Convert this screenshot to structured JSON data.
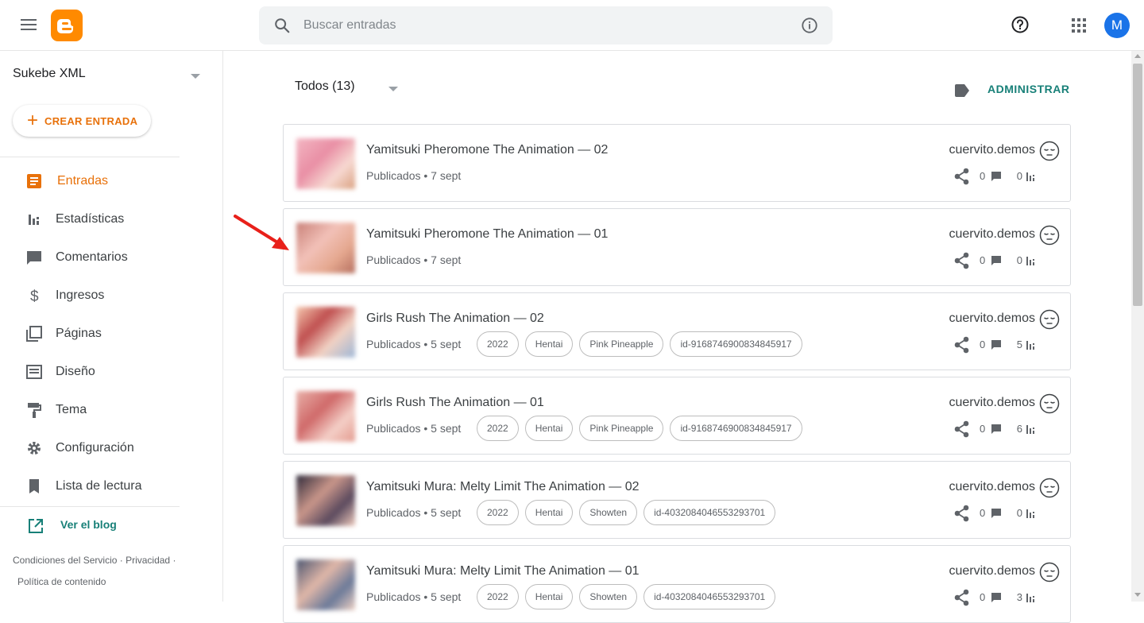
{
  "header": {
    "search_placeholder": "Buscar entradas",
    "avatar_letter": "M",
    "accent": "#ff8a00"
  },
  "sidebar": {
    "blog_name": "Sukebe XML",
    "create_label": "CREAR ENTRADA",
    "items": [
      {
        "label": "Entradas",
        "icon": "posts-icon",
        "active": true
      },
      {
        "label": "Estadísticas",
        "icon": "stats-icon"
      },
      {
        "label": "Comentarios",
        "icon": "comment-icon"
      },
      {
        "label": "Ingresos",
        "icon": "dollar-icon"
      },
      {
        "label": "Páginas",
        "icon": "pages-icon"
      },
      {
        "label": "Diseño",
        "icon": "layout-icon"
      },
      {
        "label": "Tema",
        "icon": "paint-roller-icon"
      },
      {
        "label": "Configuración",
        "icon": "gear-icon"
      },
      {
        "label": "Lista de lectura",
        "icon": "bookmark-icon"
      }
    ],
    "view_blog": "Ver el blog",
    "footer": {
      "terms": "Condiciones del Servicio",
      "privacy": "Privacidad",
      "content_policy": "Política de contenido"
    }
  },
  "main": {
    "filter_label": "Todos (13)",
    "admin_label": "ADMINISTRAR",
    "posts": [
      {
        "title": "Yamitsuki Pheromone The Animation — 02",
        "meta": "Publicados • 7 sept",
        "labels": [],
        "author": "cuervito.demos",
        "comments": "0",
        "views": "0"
      },
      {
        "title": "Yamitsuki Pheromone The Animation — 01",
        "meta": "Publicados • 7 sept",
        "labels": [],
        "author": "cuervito.demos",
        "comments": "0",
        "views": "0"
      },
      {
        "title": "Girls Rush The Animation — 02",
        "meta": "Publicados • 5 sept",
        "labels": [
          "2022",
          "Hentai",
          "Pink Pineapple",
          "id-9168746900834845917"
        ],
        "author": "cuervito.demos",
        "comments": "0",
        "views": "5"
      },
      {
        "title": "Girls Rush The Animation — 01",
        "meta": "Publicados • 5 sept",
        "labels": [
          "2022",
          "Hentai",
          "Pink Pineapple",
          "id-9168746900834845917"
        ],
        "author": "cuervito.demos",
        "comments": "0",
        "views": "6"
      },
      {
        "title": "Yamitsuki Mura: Melty Limit The Animation — 02",
        "meta": "Publicados • 5 sept",
        "labels": [
          "2022",
          "Hentai",
          "Showten",
          "id-4032084046553293701"
        ],
        "author": "cuervito.demos",
        "comments": "0",
        "views": "0"
      },
      {
        "title": "Yamitsuki Mura: Melty Limit The Animation — 01",
        "meta": "Publicados • 5 sept",
        "labels": [
          "2022",
          "Hentai",
          "Showten",
          "id-4032084046553293701"
        ],
        "author": "cuervito.demos",
        "comments": "0",
        "views": "3"
      }
    ]
  }
}
